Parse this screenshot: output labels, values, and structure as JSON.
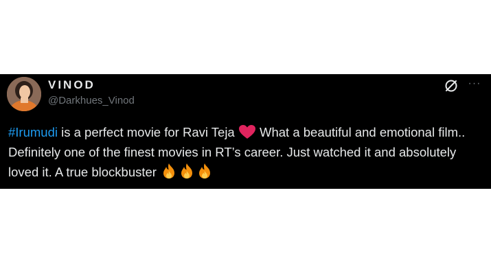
{
  "author": {
    "display_name": "VINOD",
    "handle": "@Darkhues_Vinod",
    "avatar_icon": "avatar-photo"
  },
  "header_actions": {
    "grok_icon": "grok-slash-icon",
    "more_icon": "more-horizontal-icon",
    "more_label": "···"
  },
  "tweet": {
    "hashtag": "#Irumudi",
    "text_part1": " is a perfect movie for Ravi Teja ",
    "heart_icon": "red-heart-emoji",
    "text_part2": " What a beautiful and emotional film.. Definitely one of the finest movies in RT’s career. Just watched it and absolutely loved it. A true blockbuster ",
    "fire_icon": "fire-emoji",
    "fire_count": 3
  },
  "colors": {
    "background": "#000000",
    "text": "#e7e9ea",
    "muted": "#71767b",
    "hashtag": "#1d9bf0",
    "heart": "#e0245e",
    "fire": "#f4900c"
  }
}
